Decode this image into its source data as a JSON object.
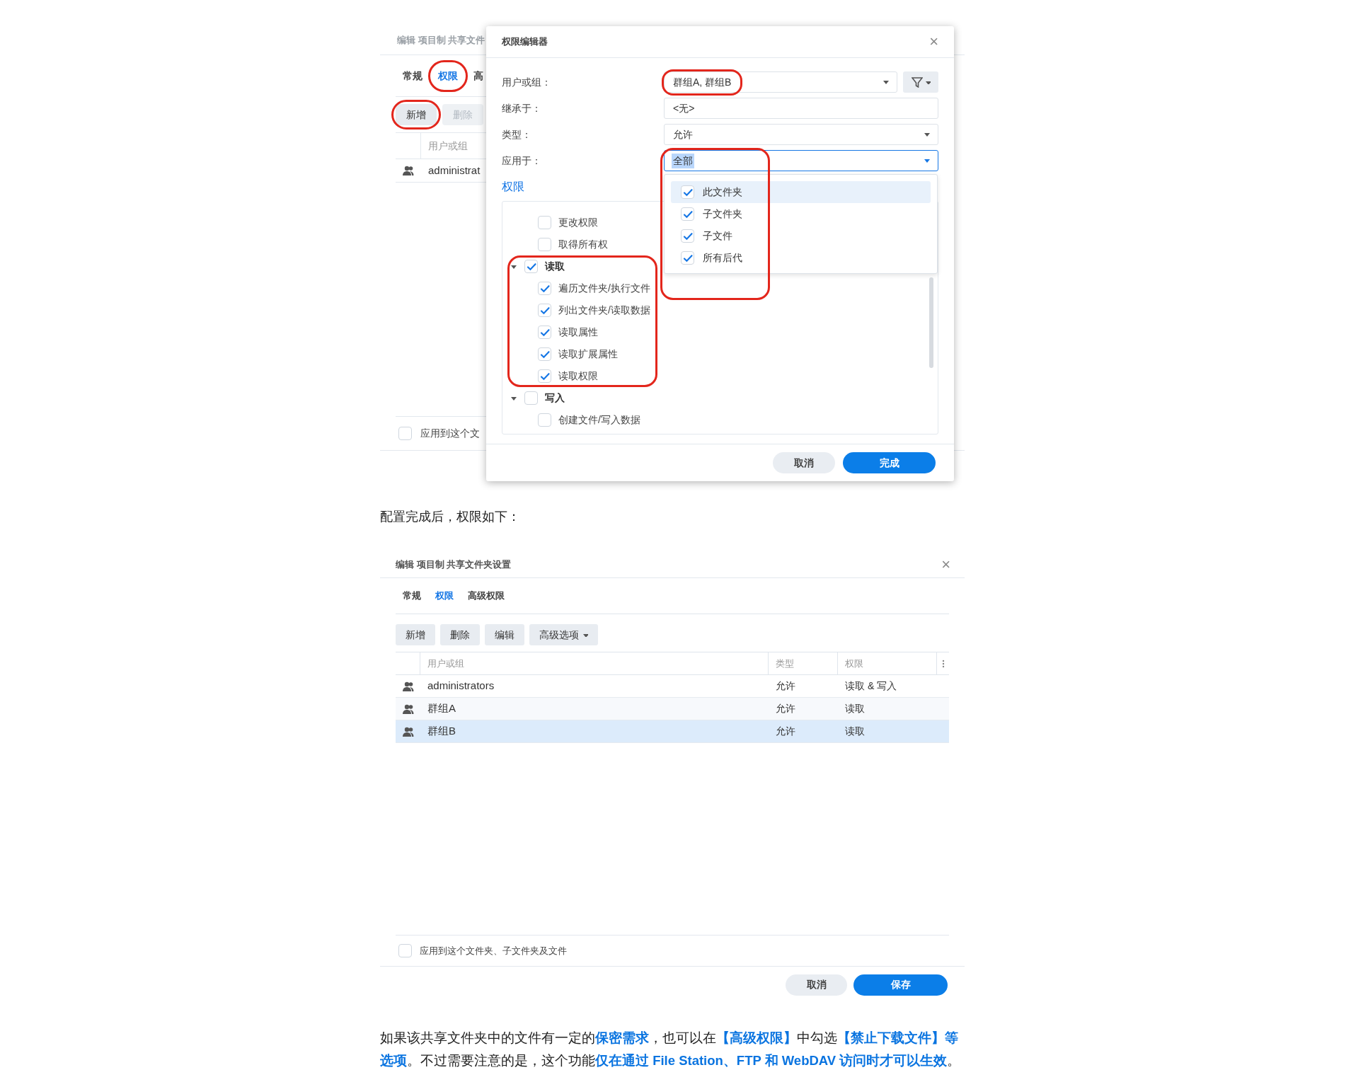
{
  "back_dialog": {
    "title": "编辑 项目制 共享文件",
    "tabs": [
      {
        "label": "常规",
        "selected": false
      },
      {
        "label": "权限",
        "selected": true,
        "highlighted": true
      },
      {
        "label": "高",
        "selected": false
      }
    ],
    "buttons": [
      {
        "label": "新增",
        "disabled": false,
        "highlighted": true
      },
      {
        "label": "删除",
        "disabled": true
      }
    ],
    "columns": [
      "用户或组"
    ],
    "rows": [
      {
        "name": "administrat"
      }
    ],
    "apply_checkbox": {
      "label": "应用到这个文",
      "checked": false
    }
  },
  "permission_editor": {
    "title": "权限编辑器",
    "close": "×",
    "fields": [
      {
        "label": "用户或组：",
        "kind": "select",
        "value": "群组A, 群组B",
        "highlighted": true,
        "filter": true,
        "focused": false
      },
      {
        "label": "继承于：",
        "kind": "text",
        "value": "<无>",
        "focused": false
      },
      {
        "label": "类型：",
        "kind": "select",
        "value": "允许",
        "focused": false
      },
      {
        "label": "应用于：",
        "kind": "select",
        "value": "全部",
        "focused": true
      }
    ],
    "apply_options": {
      "highlighted": true,
      "items": [
        {
          "label": "此文件夹",
          "checked": true,
          "selected": true
        },
        {
          "label": "子文件夹",
          "checked": true,
          "selected": false
        },
        {
          "label": "子文件",
          "checked": true,
          "selected": false
        },
        {
          "label": "所有后代",
          "checked": true,
          "selected": false
        }
      ]
    },
    "section_title": "权限",
    "permissions": [
      {
        "label": "更改权限",
        "checked": false
      },
      {
        "label": "取得所有权",
        "checked": false
      },
      {
        "label": "读取",
        "checked": true,
        "expanded": true,
        "highlighted": true,
        "children": [
          {
            "label": "遍历文件夹/执行文件",
            "checked": true
          },
          {
            "label": "列出文件夹/读取数据",
            "checked": true
          },
          {
            "label": "读取属性",
            "checked": true
          },
          {
            "label": "读取扩展属性",
            "checked": true
          },
          {
            "label": "读取权限",
            "checked": true
          }
        ]
      },
      {
        "label": "写入",
        "checked": false,
        "expanded": true,
        "children": [
          {
            "label": "创建文件/写入数据",
            "checked": false
          }
        ]
      }
    ],
    "buttons": [
      {
        "label": "取消",
        "primary": false
      },
      {
        "label": "完成",
        "primary": true
      }
    ]
  },
  "caption": "配置完成后，权限如下：",
  "settings_dialog": {
    "title": "编辑 项目制 共享文件夹设置",
    "close": "×",
    "tabs": [
      {
        "label": "常规",
        "selected": false
      },
      {
        "label": "权限",
        "selected": true
      },
      {
        "label": "高级权限",
        "selected": false
      }
    ],
    "toolbar": [
      {
        "label": "新增",
        "dropdown": false
      },
      {
        "label": "删除",
        "dropdown": false
      },
      {
        "label": "编辑",
        "dropdown": false
      },
      {
        "label": "高级选项",
        "dropdown": true
      }
    ],
    "columns": [
      "用户或组",
      "类型",
      "权限"
    ],
    "rows": [
      {
        "name": "administrators",
        "type": "允许",
        "permission": "读取 & 写入",
        "selected": false
      },
      {
        "name": "群组A",
        "type": "允许",
        "permission": "读取",
        "selected": false
      },
      {
        "name": "群组B",
        "type": "允许",
        "permission": "读取",
        "selected": true
      }
    ],
    "apply_checkbox": {
      "label": "应用到这个文件夹、子文件夹及文件",
      "checked": false
    },
    "buttons": [
      {
        "label": "取消",
        "primary": false
      },
      {
        "label": "保存",
        "primary": true
      }
    ]
  },
  "note": "如果该共享文件夹中的文件有一定的**保密需求**，也可以在**【高级权限】**中勾选**【禁止下载文件】等选项**。不过需要注意的是，这个功能**仅在通过 File Station、FTP 和 WebDAV 访问时才可以生效**。"
}
